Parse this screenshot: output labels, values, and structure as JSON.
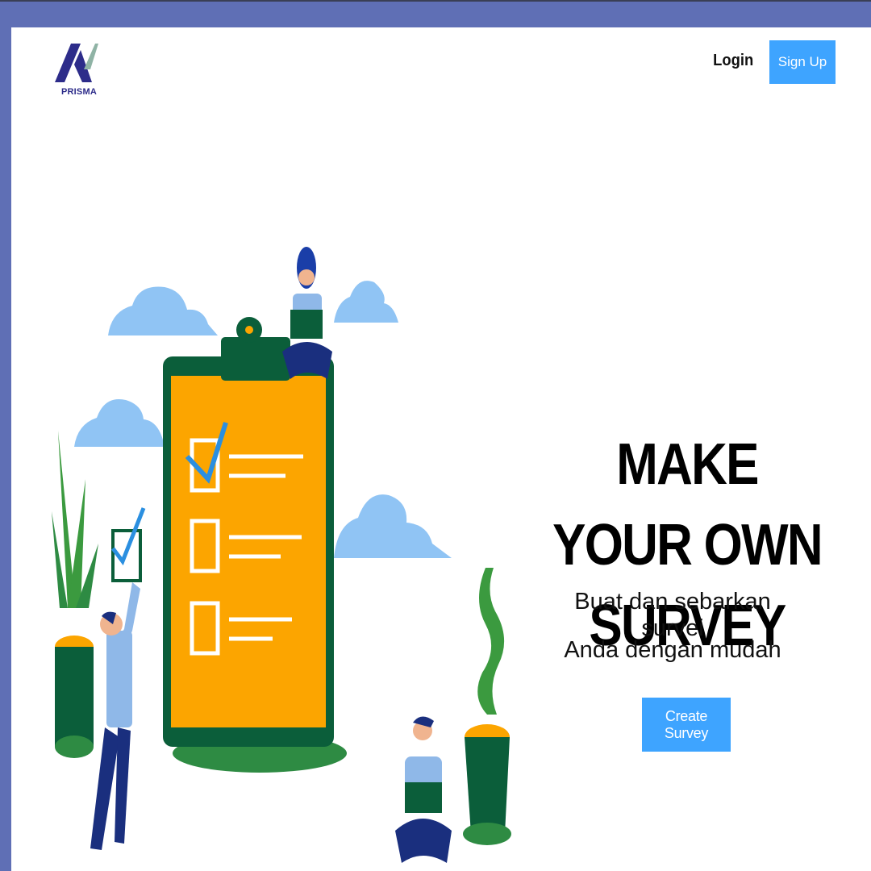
{
  "brand": {
    "name": "PRISMA",
    "colors": {
      "navy": "#2d2c8a",
      "accent": "#3ea4ff",
      "frame": "#5f6fb5"
    }
  },
  "nav": {
    "login_label": "Login",
    "signup_label": "Sign Up"
  },
  "hero": {
    "title_line1": "MAKE YOUR OWN",
    "title_line2": "SURVEY",
    "subtitle_line1": "Buat dan sebarkan survei",
    "subtitle_line2": "Anda dengan mudah",
    "cta_label": "Create Survey"
  },
  "illustration": {
    "icon": "survey-clipboard-illustration",
    "colors": {
      "clipboard": "#fca500",
      "frame": "#0b5e3a",
      "cloud": "#90c4f4",
      "plant": "#3b9a3f"
    }
  }
}
